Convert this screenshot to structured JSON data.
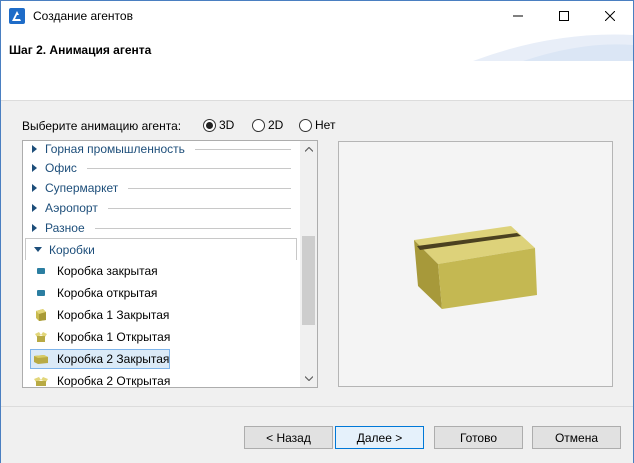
{
  "window": {
    "title": "Создание агентов",
    "icon": "anylogic-app-icon"
  },
  "header": {
    "step_title": "Шаг 2. Анимация агента"
  },
  "animation": {
    "label": "Выберите анимацию агента:",
    "options": [
      "3D",
      "2D",
      "Нет"
    ],
    "selected": "3D"
  },
  "tree": {
    "categories": [
      {
        "label": "Горная промышленность",
        "expanded": false
      },
      {
        "label": "Офис",
        "expanded": false
      },
      {
        "label": "Супермаркет",
        "expanded": false
      },
      {
        "label": "Аэропорт",
        "expanded": false
      },
      {
        "label": "Разное",
        "expanded": false
      },
      {
        "label": "Коробки",
        "expanded": true
      }
    ],
    "items": [
      {
        "label": "Коробка закрытая",
        "icon": "small-box-closed-icon"
      },
      {
        "label": "Коробка открытая",
        "icon": "small-box-open-icon"
      },
      {
        "label": "Коробка 1 Закрытая",
        "icon": "box1-closed-icon"
      },
      {
        "label": "Коробка 1 Открытая",
        "icon": "box1-open-icon"
      },
      {
        "label": "Коробка 2 Закрытая",
        "icon": "box2-closed-icon",
        "selected": true
      },
      {
        "label": "Коробка 2 Открытая",
        "icon": "box2-open-icon"
      }
    ]
  },
  "preview": {
    "object": "box2-closed-3d-model",
    "box_color": "#c8bd55"
  },
  "buttons": {
    "back": "< Назад",
    "next": "Далее >",
    "done": "Готово",
    "cancel": "Отмена"
  },
  "colors": {
    "accent": "#0078d7",
    "tree_text": "#1d4e7a",
    "selection": "#dbeaf7"
  }
}
